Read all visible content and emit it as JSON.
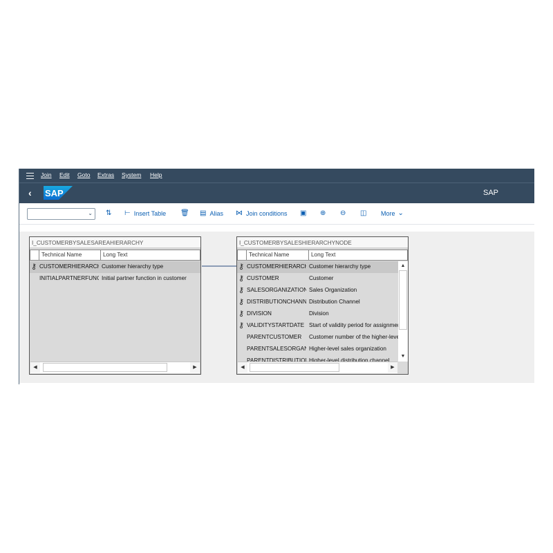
{
  "menu": [
    "Join",
    "Edit",
    "Goto",
    "Extras",
    "System",
    "Help"
  ],
  "window_title": "SAP",
  "logo_text": "SAP",
  "toolbar": {
    "dropdown_value": "",
    "insert_table": "Insert Table",
    "alias": "Alias",
    "join_conditions": "Join conditions",
    "more": "More"
  },
  "left_table": {
    "title": "I_CUSTOMERBYSALESAREAHIERARCHY",
    "col1": "Technical Name",
    "col2": "Long Text",
    "rows": [
      {
        "key": true,
        "name": "CUSTOMERHIERARCHYTYPE",
        "text": "Customer hierarchy type"
      },
      {
        "key": false,
        "name": "INITIALPARTNERFUNCTION",
        "text": "Initial partner function in customer"
      }
    ]
  },
  "right_table": {
    "title": "I_CUSTOMERBYSALESHIERARCHYNODE",
    "col1": "Technical Name",
    "col2": "Long Text",
    "rows": [
      {
        "key": true,
        "name": "CUSTOMERHIERARCHYTYPE",
        "text": "Customer hierarchy type"
      },
      {
        "key": true,
        "name": "CUSTOMER",
        "text": "Customer"
      },
      {
        "key": true,
        "name": "SALESORGANIZATION",
        "text": "Sales Organization"
      },
      {
        "key": true,
        "name": "DISTRIBUTIONCHANNEL",
        "text": "Distribution Channel"
      },
      {
        "key": true,
        "name": "DIVISION",
        "text": "Division"
      },
      {
        "key": true,
        "name": "VALIDITYSTARTDATE",
        "text": "Start of validity period for assignment"
      },
      {
        "key": false,
        "name": "PARENTCUSTOMER",
        "text": "Customer number of the higher-level"
      },
      {
        "key": false,
        "name": "PARENTSALESORGANIZATION",
        "text": "Higher-level sales organization"
      },
      {
        "key": false,
        "name": "PARENTDISTRIBUTIONCHANNEL",
        "text": "Higher-level distribution channel"
      }
    ]
  },
  "colors": {
    "shell": "#354a5f",
    "link": "#0a5eb2",
    "canvas": "#efefef",
    "table_body": "#dadada"
  }
}
